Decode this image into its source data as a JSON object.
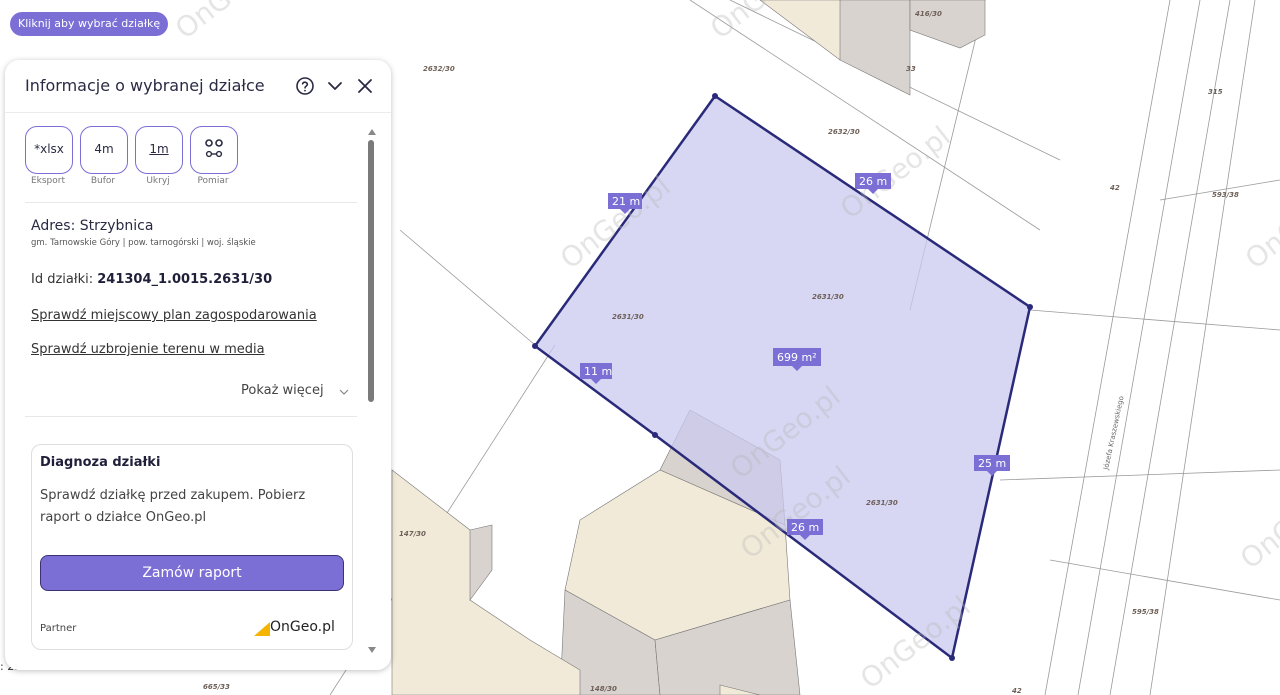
{
  "map": {
    "parcel_labels": [
      "2632/30",
      "416/30",
      "33",
      "315",
      "2632/30",
      "42",
      "593/38",
      "2631/30",
      "2631/30",
      "2631/30",
      "147/30",
      "595/38",
      "665/33",
      "148/30",
      "42"
    ],
    "street_label": "Józefa Kraszewskiego",
    "watermark": "OnGeo.pl",
    "dimensions": [
      "21 m",
      "26 m",
      "11 m",
      "25 m",
      "26 m"
    ],
    "area": "699 m²",
    "scale_text": ": 2..."
  },
  "select_chip": "Kliknij aby wybrać działkę",
  "panel": {
    "title": "Informacje o wybranej działce",
    "help_icon": "question-circle-icon",
    "collapse_icon": "chevron-down-icon",
    "close_icon": "close-icon",
    "tools": [
      {
        "value": "*xlsx",
        "label": "Eksport"
      },
      {
        "value": "4m",
        "label": "Bufor"
      },
      {
        "value": "1m",
        "label": "Ukryj"
      },
      {
        "value": "",
        "label": "Pomiar"
      }
    ],
    "address_title": "Adres: Strzybnica",
    "address_sub": "gm. Tarnowskie Góry | pow. tarnogórski | woj. śląskie",
    "parcel_id_label": "Id działki:",
    "parcel_id_value": "241304_1.0015.2631/30",
    "link_plan": "Sprawdź miejscowy plan zagospodarowania",
    "link_media": "Sprawdź uzbrojenie terenu w media",
    "show_more": "Pokaż więcej",
    "diag": {
      "title": "Diagnoza działki",
      "text": "Sprawdź działkę przed zakupem. Pobierz raport o działce OnGeo.pl",
      "button": "Zamów raport",
      "partner": "Partner",
      "logo": "OnGeo.pl"
    }
  },
  "colors": {
    "accent": "#7b6fd6",
    "parcel_outline": "#2a2a7a",
    "parcel_fill": "#c9c9ef",
    "building_top": "#f1ead8",
    "building_side": "#d9d3cf"
  }
}
